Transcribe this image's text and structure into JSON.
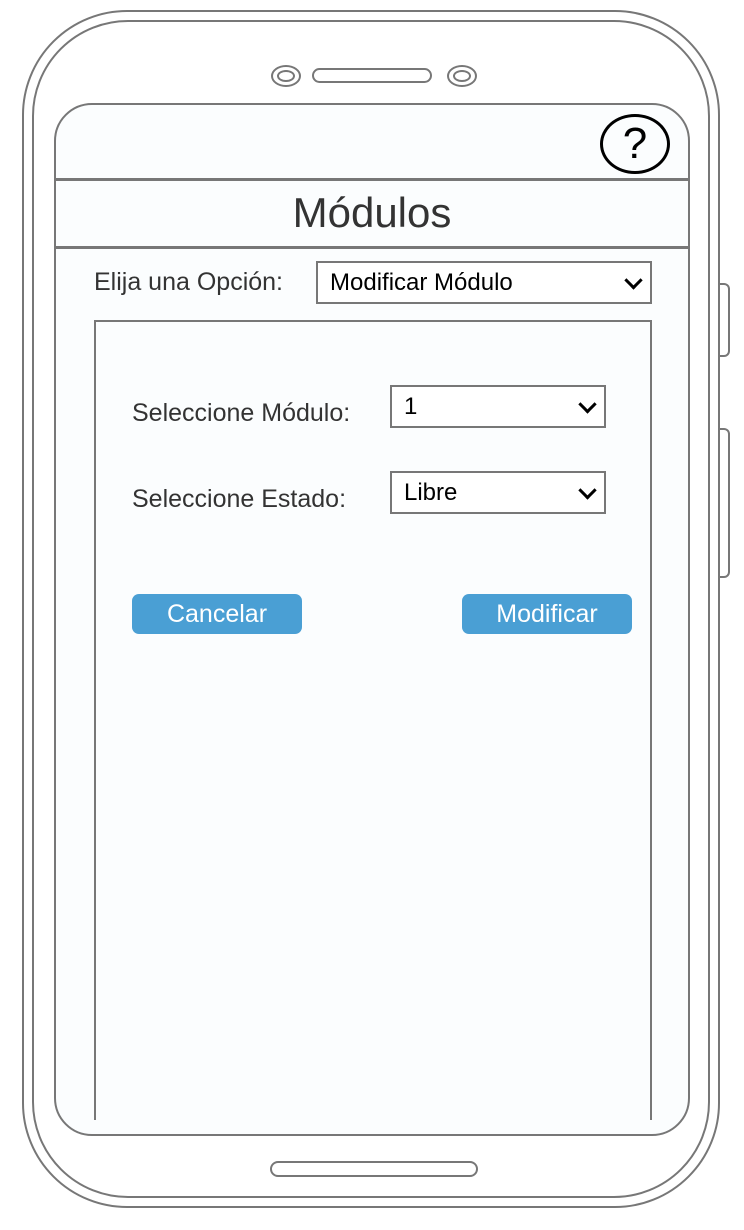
{
  "header": {
    "help_icon": "help-circle-icon",
    "help_glyph": "?",
    "title": "Módulos"
  },
  "option": {
    "label": "Elija una Opción:",
    "selected": "Modificar Módulo"
  },
  "form": {
    "modulo_label": "Seleccione Módulo:",
    "modulo_value": "1",
    "estado_label": "Seleccione Estado:",
    "estado_value": "Libre"
  },
  "actions": {
    "cancel_label": "Cancelar",
    "modify_label": "Modificar"
  },
  "colors": {
    "button": "#4a9fd4",
    "frame": "#777777",
    "screen_bg": "#fbfdfe"
  }
}
